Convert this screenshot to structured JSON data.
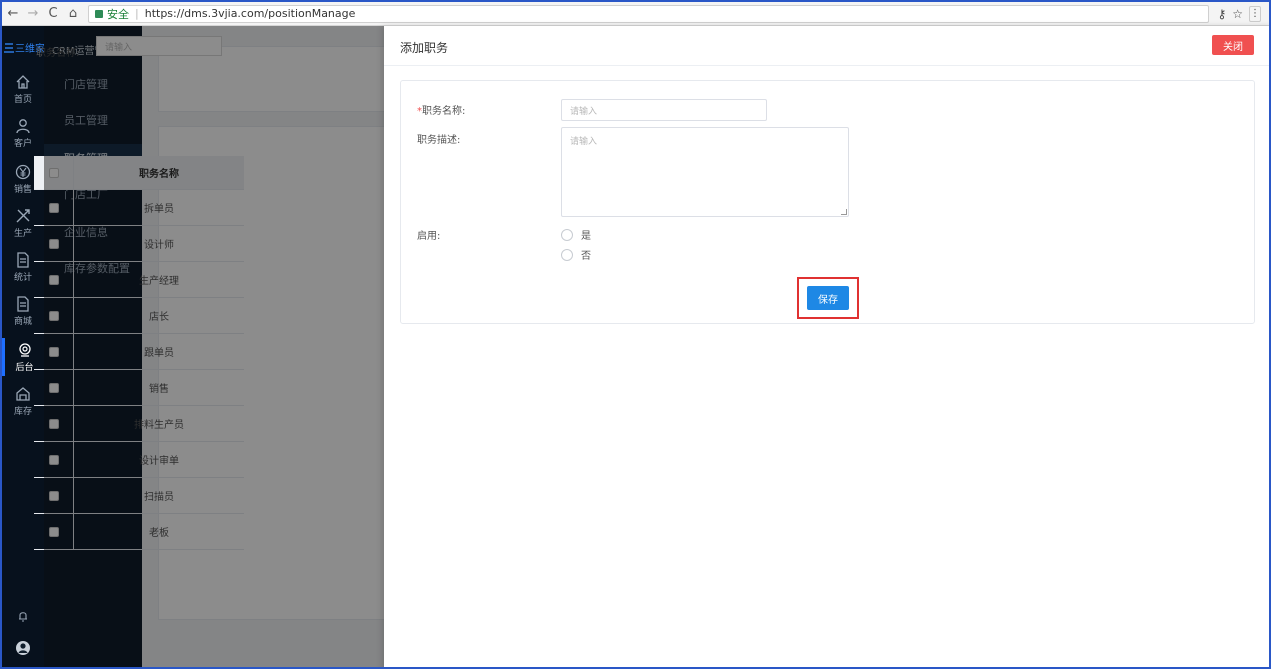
{
  "browser": {
    "secure_label": "安全",
    "url": "https://dms.3vjia.com/positionManage"
  },
  "brand": {
    "logo_text": "三维家",
    "system_name": "CRM运营管理系统"
  },
  "rail": [
    {
      "label": "首页",
      "icon": "home-icon"
    },
    {
      "label": "客户",
      "icon": "customer-icon"
    },
    {
      "label": "销售",
      "icon": "yen-icon"
    },
    {
      "label": "生产",
      "icon": "tools-icon"
    },
    {
      "label": "统计",
      "icon": "document-icon"
    },
    {
      "label": "商城",
      "icon": "document-icon"
    },
    {
      "label": "后台",
      "icon": "headset-icon",
      "active": true
    },
    {
      "label": "库存",
      "icon": "warehouse-icon"
    }
  ],
  "sidebar": {
    "items": [
      {
        "label": "门店管理"
      },
      {
        "label": "员工管理"
      },
      {
        "label": "职务管理",
        "active": true
      },
      {
        "label": "门店工厂"
      },
      {
        "label": "企业信息"
      },
      {
        "label": "库存参数配置"
      }
    ]
  },
  "filter": {
    "label": "职务名称:",
    "placeholder": "请输入"
  },
  "table": {
    "header": "职务名称",
    "rows": [
      "拆单员",
      "设计师",
      "生产经理",
      "店长",
      "跟单员",
      "销售",
      "排料生产员",
      "设计审单",
      "扫描员",
      "老板"
    ]
  },
  "drawer": {
    "title": "添加职务",
    "close_label": "关闭",
    "form": {
      "name_label": "职务名称:",
      "name_required_mark": "*",
      "name_placeholder": "请输入",
      "desc_label": "职务描述:",
      "desc_placeholder": "请输入",
      "enable_label": "启用:",
      "option_yes": "是",
      "option_no": "否",
      "save_label": "保存"
    }
  },
  "colors": {
    "accent": "#1e88e5",
    "danger": "#f05050",
    "highlight": "#e03131"
  }
}
